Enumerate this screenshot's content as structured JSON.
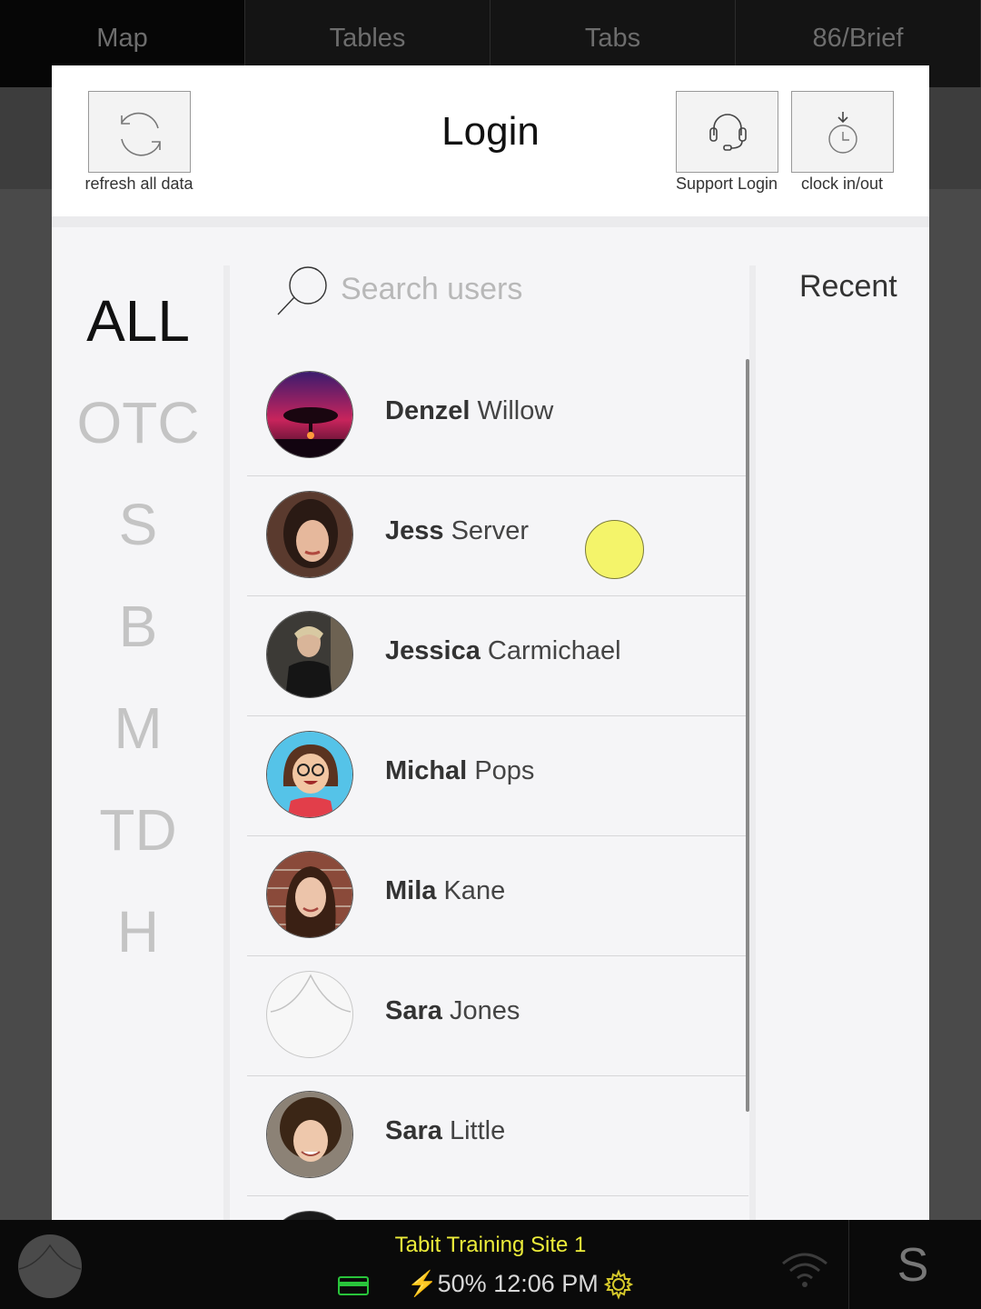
{
  "top_nav": {
    "tabs": [
      {
        "label": "Map"
      },
      {
        "label": "Tables"
      },
      {
        "label": "Tabs"
      },
      {
        "label": "86/Brief"
      }
    ]
  },
  "modal": {
    "title": "Login",
    "refresh_button": {
      "label": "refresh all data",
      "icon": "refresh-icon"
    },
    "support_button": {
      "label": "Support Login",
      "icon": "headset-icon"
    },
    "clock_button": {
      "label": "clock in/out",
      "icon": "clock-icon"
    }
  },
  "letter_filter": {
    "items": [
      "ALL",
      "OTC",
      "S",
      "B",
      "M",
      "TD",
      "H"
    ],
    "selected": "ALL"
  },
  "search": {
    "placeholder": "Search users",
    "value": "",
    "icon": "search-icon"
  },
  "recent": {
    "label": "Recent"
  },
  "users": [
    {
      "first": "Denzel",
      "last": "Willow",
      "avatar": "sunset-tree-photo"
    },
    {
      "first": "Jess",
      "last": "Server",
      "avatar": "woman-portrait-photo"
    },
    {
      "first": "Jessica",
      "last": "Carmichael",
      "avatar": "woman-drinking-photo"
    },
    {
      "first": "Michal",
      "last": "Pops",
      "avatar": "cartoon-woman-glasses"
    },
    {
      "first": "Mila",
      "last": "Kane",
      "avatar": "woman-brick-wall-photo"
    },
    {
      "first": "Sara",
      "last": "Jones",
      "avatar": "default-avatar"
    },
    {
      "first": "Sara",
      "last": "Little",
      "avatar": "curly-hair-woman-photo"
    }
  ],
  "bottom_bar": {
    "site_name": "Tabit Training Site 1",
    "battery": "⚡50%",
    "time": "12:06 PM",
    "user_initial": "S",
    "colors": {
      "site_name": "#ecec3a",
      "card_icon": "#29c43b",
      "gear_icon": "#d6c92b"
    }
  }
}
